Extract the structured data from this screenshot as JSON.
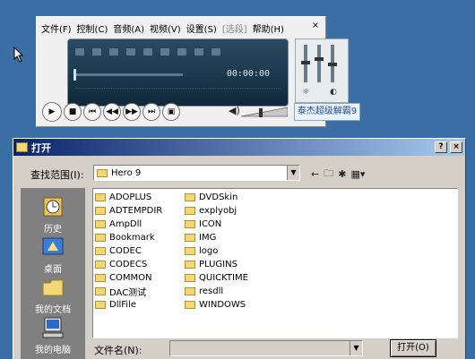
{
  "player": {
    "menu": [
      {
        "label": "文件(F)",
        "enabled": true
      },
      {
        "label": "控制(C)",
        "enabled": true
      },
      {
        "label": "音频(A)",
        "enabled": true
      },
      {
        "label": "视频(V)",
        "enabled": true
      },
      {
        "label": "设置(S)",
        "enabled": true
      },
      {
        "label": "[选段]",
        "enabled": false
      },
      {
        "label": "帮助(H)",
        "enabled": true
      }
    ],
    "close_label": "×",
    "time": "00:00:00",
    "brand": "泰杰超级解霸9",
    "controls": [
      "play-icon",
      "stop-icon",
      "skip-start-icon",
      "rewind-icon",
      "fast-forward-icon",
      "skip-end-icon",
      "screen-mode-icon"
    ]
  },
  "dialog": {
    "title": "打开",
    "help_button": "?",
    "close_button": "×",
    "lookin_label": "查找范围(I):",
    "lookin_value": "Hero 9",
    "places": [
      {
        "label": "历史",
        "icon": "history-icon"
      },
      {
        "label": "桌面",
        "icon": "desktop-icon"
      },
      {
        "label": "我的文档",
        "icon": "my-documents-icon"
      },
      {
        "label": "我的电脑",
        "icon": "my-computer-icon"
      }
    ],
    "files_col1": [
      "ADOPLUS",
      "ADTEMPDIR",
      "AmpDll",
      "Bookmark",
      "CODEC",
      "CODECS",
      "COMMON",
      "DAC测试",
      "DllFile"
    ],
    "files_col2": [
      "DVDSkin",
      "explyobj",
      "ICON",
      "IMG",
      "logo",
      "PLUGINS",
      "QUICKTIME",
      "resdll",
      "WINDOWS"
    ],
    "filename_label": "文件名(N):",
    "filename_value": "",
    "open_button": "打开(O)"
  }
}
